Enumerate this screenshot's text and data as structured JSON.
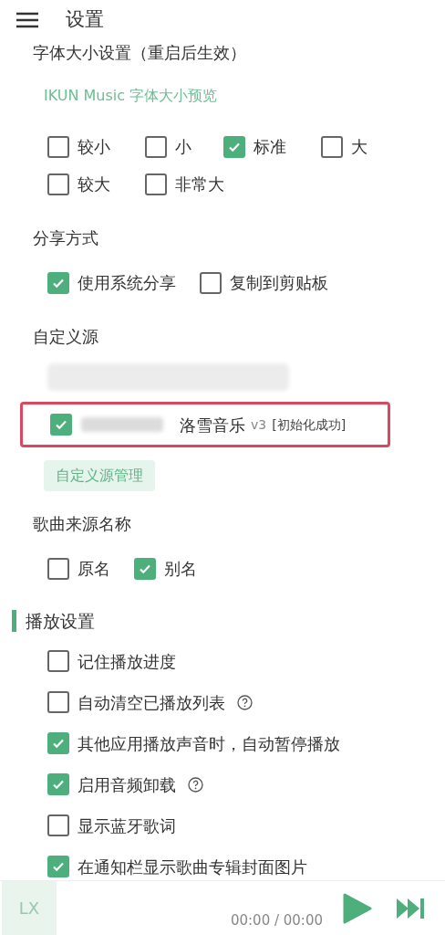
{
  "header": {
    "title": "设置"
  },
  "font_size": {
    "title": "字体大小设置（重启后生效）",
    "preview": "IKUN Music 字体大小预览",
    "options": [
      {
        "label": "较小",
        "selected": false
      },
      {
        "label": "小",
        "selected": false
      },
      {
        "label": "标准",
        "selected": true
      },
      {
        "label": "大",
        "selected": false
      },
      {
        "label": "较大",
        "selected": false
      },
      {
        "label": "非常大",
        "selected": false
      }
    ]
  },
  "share": {
    "title": "分享方式",
    "options": [
      {
        "label": "使用系统分享",
        "checked": true
      },
      {
        "label": "复制到剪贴板",
        "checked": false
      }
    ]
  },
  "custom_source": {
    "title": "自定义源",
    "items": [
      {
        "kind": "redacted"
      },
      {
        "kind": "source",
        "checked": true,
        "highlighted": true,
        "name": "洛雪音乐",
        "version": "v3",
        "status": "[初始化成功]"
      }
    ],
    "manage_button": "自定义源管理"
  },
  "song_source_name": {
    "title": "歌曲来源名称",
    "options": [
      {
        "label": "原名",
        "checked": false
      },
      {
        "label": "别名",
        "checked": true
      }
    ]
  },
  "playback": {
    "title": "播放设置",
    "items": [
      {
        "label": "记住播放进度",
        "checked": false,
        "help": false
      },
      {
        "label": "自动清空已播放列表",
        "checked": false,
        "help": true
      },
      {
        "label": "其他应用播放声音时，自动暂停播放",
        "checked": true,
        "help": false
      },
      {
        "label": "启用音频卸载",
        "checked": true,
        "help": true
      },
      {
        "label": "显示蓝牙歌词",
        "checked": false,
        "help": false
      },
      {
        "label": "在通知栏显示歌曲专辑封面图片",
        "checked": true,
        "help": false
      }
    ]
  },
  "player": {
    "cover_text": "LX",
    "time": "00:00 / 00:00"
  }
}
